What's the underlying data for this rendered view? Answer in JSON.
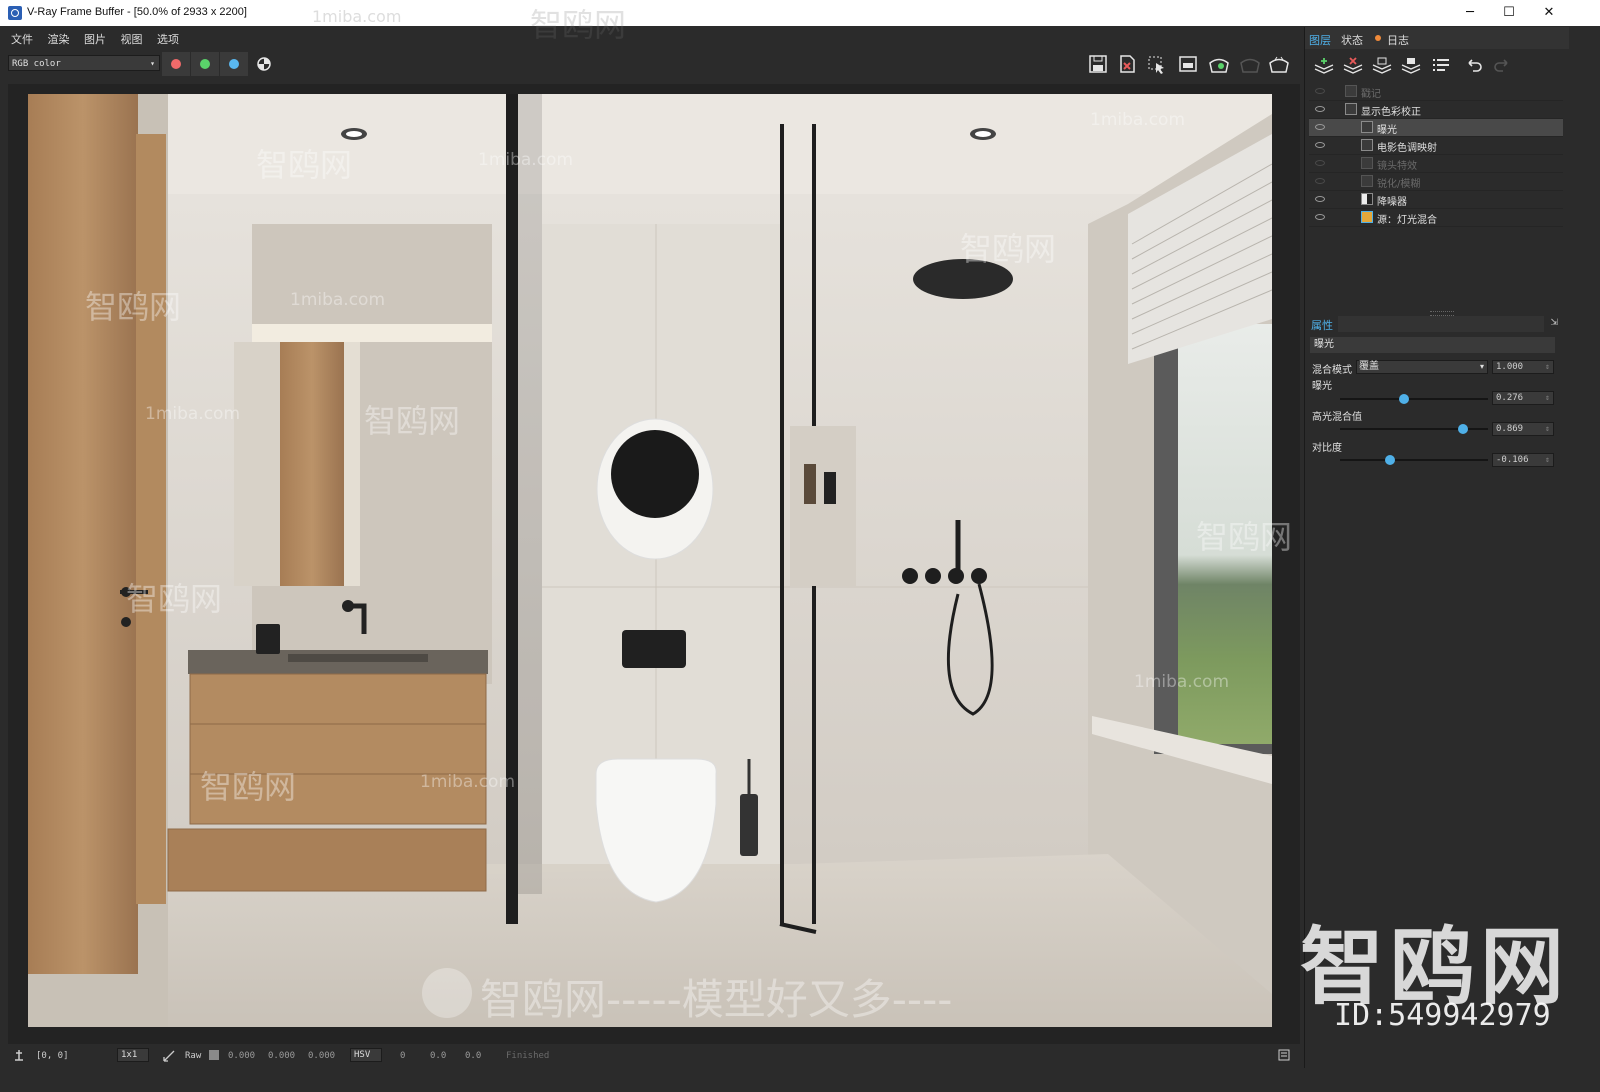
{
  "window": {
    "title": "V-Ray Frame Buffer - [50.0% of 2933 x 2200]",
    "minimize": "─",
    "maximize": "☐",
    "close": "✕"
  },
  "menu": [
    "文件",
    "渲染",
    "图片",
    "视图",
    "选项"
  ],
  "toolbar": {
    "channel": "RGB color",
    "channel_buttons": [
      {
        "name": "red-channel-button",
        "color": "#f06a6a"
      },
      {
        "name": "green-channel-button",
        "color": "#5ad26a"
      },
      {
        "name": "blue-channel-button",
        "color": "#5ab8f0"
      }
    ],
    "right_icons": [
      "save-icon",
      "clear-icon",
      "region-render-icon",
      "compare-icon",
      "render-icon",
      "stop-icon",
      "teapot-icon"
    ]
  },
  "panel": {
    "tabs": [
      {
        "label": "图层",
        "active": true
      },
      {
        "label": "状态",
        "active": false
      },
      {
        "label": "日志",
        "active": false
      }
    ],
    "tools": [
      "add-layer-icon",
      "delete-layer-icon",
      "load-layers-icon",
      "save-layers-icon",
      "layer-list-icon",
      "undo-icon",
      "redo-icon"
    ],
    "layers": [
      {
        "label": "戳记",
        "indent": 0,
        "enabled": false,
        "selected": false
      },
      {
        "label": "显示色彩校正",
        "indent": 0,
        "enabled": true,
        "selected": false
      },
      {
        "label": "曝光",
        "indent": 1,
        "enabled": true,
        "selected": true
      },
      {
        "label": "电影色调映射",
        "indent": 1,
        "enabled": true,
        "selected": false
      },
      {
        "label": "镜头特效",
        "indent": 1,
        "enabled": false,
        "selected": false
      },
      {
        "label": "锐化/模糊",
        "indent": 1,
        "enabled": false,
        "selected": false
      },
      {
        "label": "降噪器",
        "indent": 1,
        "enabled": true,
        "selected": false
      },
      {
        "label": "源：灯光混合",
        "indent": 1,
        "enabled": true,
        "selected": false
      }
    ],
    "properties": {
      "header": "属性",
      "name": "曝光",
      "blend_mode_label": "混合模式",
      "blend_mode_value": "覆盖",
      "blend_amount": "1.000",
      "sliders": [
        {
          "label": "曝光",
          "value": "0.276",
          "level": 0.43
        },
        {
          "label": "高光混合值",
          "value": "0.869",
          "level": 0.83
        },
        {
          "label": "对比度",
          "value": "-0.106",
          "level": 0.34
        }
      ]
    }
  },
  "statusbar": {
    "coords": "[0, 0]",
    "zoom": "1x1",
    "raw": "Raw",
    "rgb": [
      "0.000",
      "0.000",
      "0.000"
    ],
    "color_mode": "HSV",
    "hsv": [
      "0",
      "0.0",
      "0.0"
    ],
    "status": "Finished"
  },
  "watermarks": {
    "site": "1miba.com",
    "brand": "智鸥网",
    "slogan": "智鸥网-----模型好又多----",
    "big_logo": "智鸥网",
    "id": "ID:549942979"
  }
}
